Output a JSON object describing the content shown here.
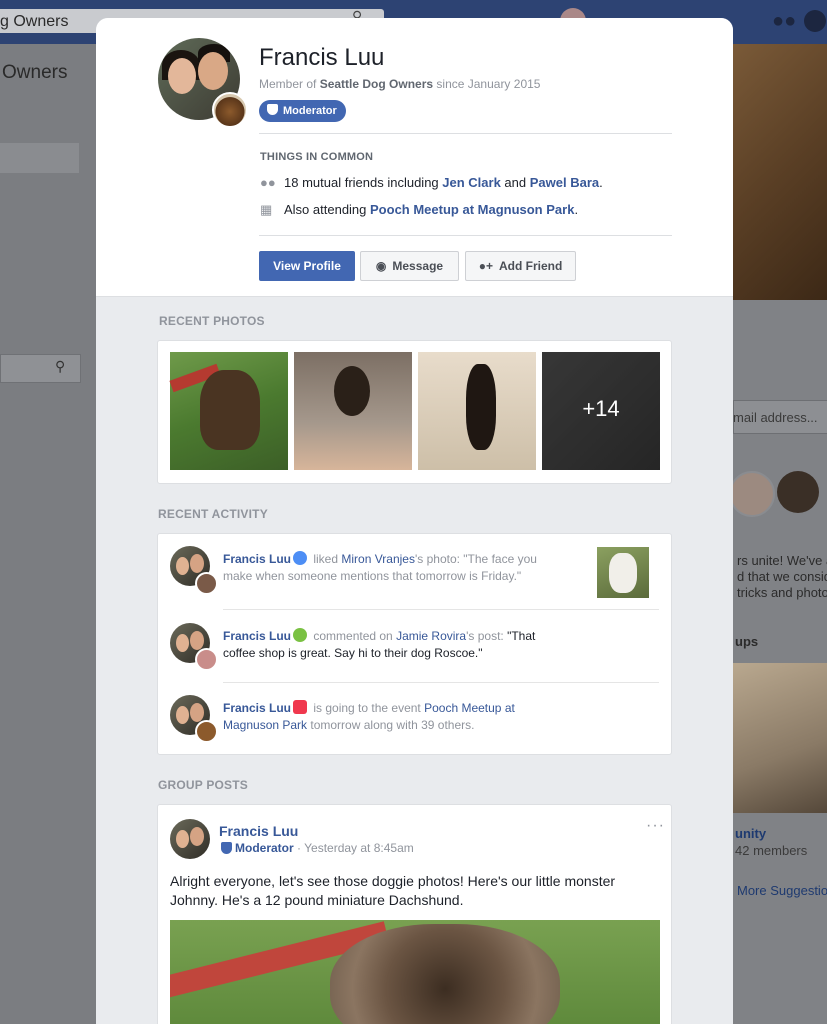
{
  "background": {
    "search_text": "g Owners",
    "left_title": "Owners",
    "email_placeholder": "mail address...",
    "desc_lines": [
      "rs unite! We've a",
      "d that we consid",
      " tricks and photo"
    ],
    "groups_label": "ups",
    "group_name": "unity",
    "group_members": "42 members",
    "more_suggestions": "More Suggestio"
  },
  "profile": {
    "name": "Francis Luu",
    "member_prefix": "Member of ",
    "group": "Seattle Dog Owners",
    "member_suffix": " since January 2015",
    "badge": "Moderator"
  },
  "common": {
    "title": "THINGS IN COMMON",
    "friends_prefix": "18 mutual friends including ",
    "friend1": "Jen Clark",
    "and": " and ",
    "friend2": "Pawel Bara",
    "period": ".",
    "event_prefix": "Also attending ",
    "event": "Pooch Meetup at Magnuson Park",
    "event_period": "."
  },
  "actions": {
    "view_profile": "View Profile",
    "message": "Message",
    "add_friend": "Add Friend"
  },
  "photos": {
    "title": "RECENT PHOTOS",
    "more_count": "+14"
  },
  "activity": {
    "title": "RECENT ACTIVITY",
    "items": [
      {
        "who": "Francis Luu",
        "verb": " liked ",
        "target": "Miron Vranjes",
        "suffix": "'s photo: ",
        "quote": "\"The face you make when someone mentions that tomorrow is Friday.\"",
        "icon": "like-icon"
      },
      {
        "who": "Francis Luu",
        "verb": " commented on ",
        "target": "Jamie Rovira",
        "suffix": "'s post: ",
        "quote": "\"That coffee shop is great. Say hi to their dog Roscoe.\"",
        "icon": "comment-icon"
      },
      {
        "who": "Francis Luu",
        "verb": " is going to the event ",
        "target": "Pooch Meetup at Magnuson Park",
        "suffix": " tomorrow along with 39 others.",
        "icon": "event-icon"
      }
    ]
  },
  "posts": {
    "title": "GROUP POSTS",
    "author": "Francis Luu",
    "role": "Moderator",
    "time": " · Yesterday at 8:45am",
    "dots": "···",
    "body": "Alright everyone, let's see those doggie photos! Here's our little monster Johnny. He's a 12 pound miniature Dachshund."
  },
  "colors": {
    "accent": "#4267b2",
    "link": "#385898",
    "like": "#4d8ef5",
    "comment": "#7ac143",
    "event": "#f0384e"
  }
}
